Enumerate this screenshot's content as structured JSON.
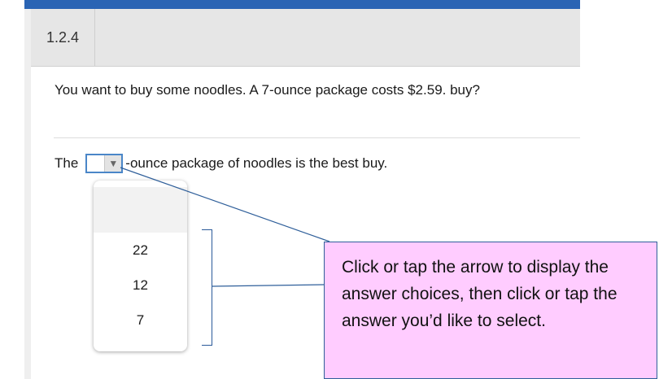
{
  "question": {
    "number": "1.2.4",
    "text": "You want to buy some noodles. A 7-ounce package costs $2.59. buy?"
  },
  "answer": {
    "prefix": "The",
    "suffix": "-ounce package of noodles is the best buy.",
    "arrow_icon": "triangle-down"
  },
  "dropdown": {
    "options": [
      "22",
      "12",
      "7"
    ]
  },
  "callout": {
    "text": "Click or tap the arrow to display the answer choices, then click or tap the answer you’d like to select.",
    "background": "#ffccff",
    "border_color": "#2f5f9a"
  },
  "colors": {
    "accent": "#2a64b4",
    "select_border": "#4a86c8"
  }
}
